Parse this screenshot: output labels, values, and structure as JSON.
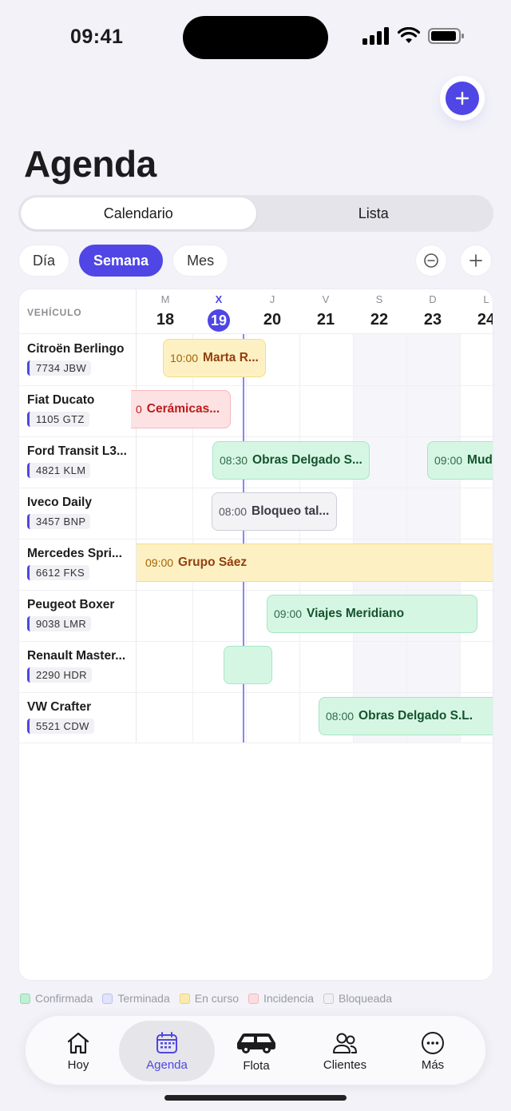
{
  "status": {
    "time": "09:41"
  },
  "header": {
    "title": "Agenda",
    "add_button_icon": "plus-icon"
  },
  "segmented": [
    "Calendario",
    "Lista"
  ],
  "segmented_active": "Calendario",
  "views": [
    "Día",
    "Semana",
    "Mes"
  ],
  "views_active": "Semana",
  "zoom": {
    "out_icon": "zoom-out-icon",
    "in_icon": "zoom-in-icon"
  },
  "calendar": {
    "vehicle_header": "VEHÍCULO",
    "days": [
      {
        "letter": "M",
        "num": "18"
      },
      {
        "letter": "X",
        "num": "19",
        "today": true
      },
      {
        "letter": "J",
        "num": "20"
      },
      {
        "letter": "V",
        "num": "21"
      },
      {
        "letter": "S",
        "num": "22"
      },
      {
        "letter": "D",
        "num": "23"
      },
      {
        "letter": "L",
        "num": "24"
      }
    ],
    "vehicles": [
      {
        "name": "Citroën Berlingo",
        "plate": "7734 JBW"
      },
      {
        "name": "Fiat Ducato",
        "plate": "1105 GTZ"
      },
      {
        "name": "Ford Transit L3...",
        "plate": "4821 KLM"
      },
      {
        "name": "Iveco Daily",
        "plate": "3457 BNP"
      },
      {
        "name": "Mercedes Spri...",
        "plate": "6612 FKS"
      },
      {
        "name": "Peugeot Boxer",
        "plate": "9038 LMR"
      },
      {
        "name": "Renault Master...",
        "plate": "2290 HDR"
      },
      {
        "name": "VW Crafter",
        "plate": "5521 CDW"
      }
    ],
    "events": [
      {
        "vehicle": 0,
        "time": "10:00",
        "label": "Marta R...",
        "status": "En curso"
      },
      {
        "vehicle": 1,
        "time": "0",
        "label": "Cerámicas...",
        "status": "Incidencia"
      },
      {
        "vehicle": 2,
        "time": "08:30",
        "label": "Obras Delgado S...",
        "status": "Confirmada"
      },
      {
        "vehicle": 2,
        "time": "09:00",
        "label": "Mud",
        "status": "Confirmada"
      },
      {
        "vehicle": 3,
        "time": "08:00",
        "label": "Bloqueo tal...",
        "status": "Bloqueada"
      },
      {
        "vehicle": 4,
        "time": "09:00",
        "label": "Grupo Sáez",
        "status": "En curso"
      },
      {
        "vehicle": 5,
        "time": "09:00",
        "label": "Viajes Meridiano",
        "status": "Confirmada"
      },
      {
        "vehicle": 6,
        "time": "",
        "label": "",
        "status": "Confirmada"
      },
      {
        "vehicle": 7,
        "time": "08:00",
        "label": "Obras Delgado S.L.",
        "status": "Confirmada"
      }
    ]
  },
  "legend": [
    {
      "label": "Confirmada",
      "color": "#bff0d3",
      "border": "#8fdcb0"
    },
    {
      "label": "Terminada",
      "color": "#dfe3fb",
      "border": "#b9c1f3"
    },
    {
      "label": "En curso",
      "color": "#fbeab0",
      "border": "#f1d277"
    },
    {
      "label": "Incidencia",
      "color": "#fbdde0",
      "border": "#f3b6bd"
    },
    {
      "label": "Bloqueada",
      "color": "#f1f1f4",
      "border": "#c9c9d0"
    }
  ],
  "tabbar": [
    {
      "label": "Hoy",
      "icon": "home-icon"
    },
    {
      "label": "Agenda",
      "icon": "calendar-icon",
      "active": true
    },
    {
      "label": "Flota",
      "icon": "car-icon"
    },
    {
      "label": "Clientes",
      "icon": "users-icon"
    },
    {
      "label": "Más",
      "icon": "more-icon"
    }
  ],
  "colors": {
    "accent": "#4f46e5"
  }
}
